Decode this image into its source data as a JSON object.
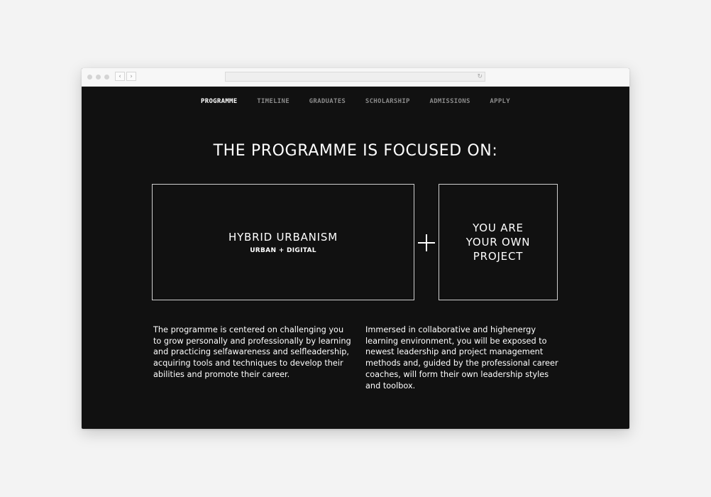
{
  "nav": {
    "items": [
      {
        "label": "PROGRAMME",
        "active": true
      },
      {
        "label": "TIMELINE",
        "active": false
      },
      {
        "label": "GRADUATES",
        "active": false
      },
      {
        "label": "SCHOLARSHIP",
        "active": false
      },
      {
        "label": "ADMISSIONS",
        "active": false
      },
      {
        "label": "APPLY",
        "active": false
      }
    ]
  },
  "headline": "THE PROGRAMME IS FOCUSED ON:",
  "focus": {
    "left": {
      "title": "HYBRID URBANISM",
      "subtitle": "URBAN + DIGITAL"
    },
    "right": {
      "title": "YOU ARE\nYOUR OWN\nPROJECT"
    }
  },
  "paragraphs": {
    "left": "The programme is centered on challenging you to grow personally and professionally by learning and practicing selfawareness and selfleadership, acquiring tools and techniques to develop their abilities and promote their career.",
    "right": "Immersed in collaborative and highenergy learning environment, you will be exposed to newest leadership and project management methods and, guided by the professional career coaches, will form their own leadership styles and toolbox."
  },
  "colors": {
    "background": "#f3f3f3",
    "page": "#111111",
    "text": "#ffffff",
    "nav_inactive": "#8a8a8a",
    "box_border": "#cfcfcf"
  },
  "icons": {
    "browser_back": "chevron-left-icon",
    "browser_forward": "chevron-right-icon",
    "reload": "reload-icon",
    "plus": "plus-icon"
  }
}
